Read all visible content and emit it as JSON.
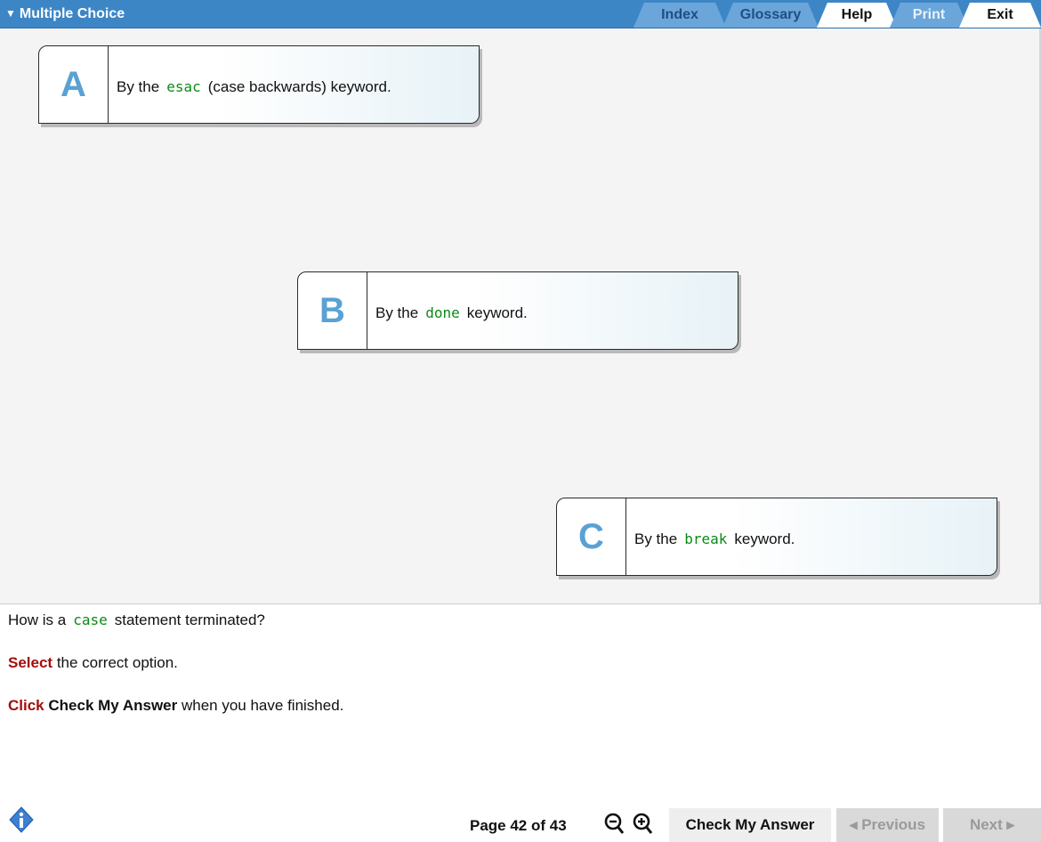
{
  "header": {
    "title": "Multiple Choice",
    "tabs": [
      {
        "label": "Index"
      },
      {
        "label": "Glossary"
      },
      {
        "label": "Help"
      },
      {
        "label": "Print"
      },
      {
        "label": "Exit"
      }
    ]
  },
  "options": [
    {
      "letter": "A",
      "before": "By the",
      "code": "esac",
      "after": "(case backwards) keyword."
    },
    {
      "letter": "B",
      "before": "By the",
      "code": "done",
      "after": "keyword."
    },
    {
      "letter": "C",
      "before": "By the",
      "code": "break",
      "after": "keyword."
    }
  ],
  "question": {
    "before": "How is a",
    "code": "case",
    "after": "statement terminated?"
  },
  "instructions": {
    "select_word": "Select",
    "select_rest": "the correct option.",
    "click_word": "Click",
    "click_bold": "Check My Answer",
    "click_rest": "when you have finished."
  },
  "footer": {
    "page_info": "Page 42 of 43",
    "check_label": "Check My Answer",
    "prev_label": "◂ Previous",
    "next_label": "Next ▸"
  },
  "colors": {
    "header_bg": "#3d86c6",
    "code_green": "#0a8a17",
    "instruction_red": "#a40d0d",
    "letter_blue": "#5aa1d4"
  },
  "icons": [
    "chevron-down-icon",
    "info-icon",
    "zoom-out-icon",
    "zoom-in-icon"
  ]
}
